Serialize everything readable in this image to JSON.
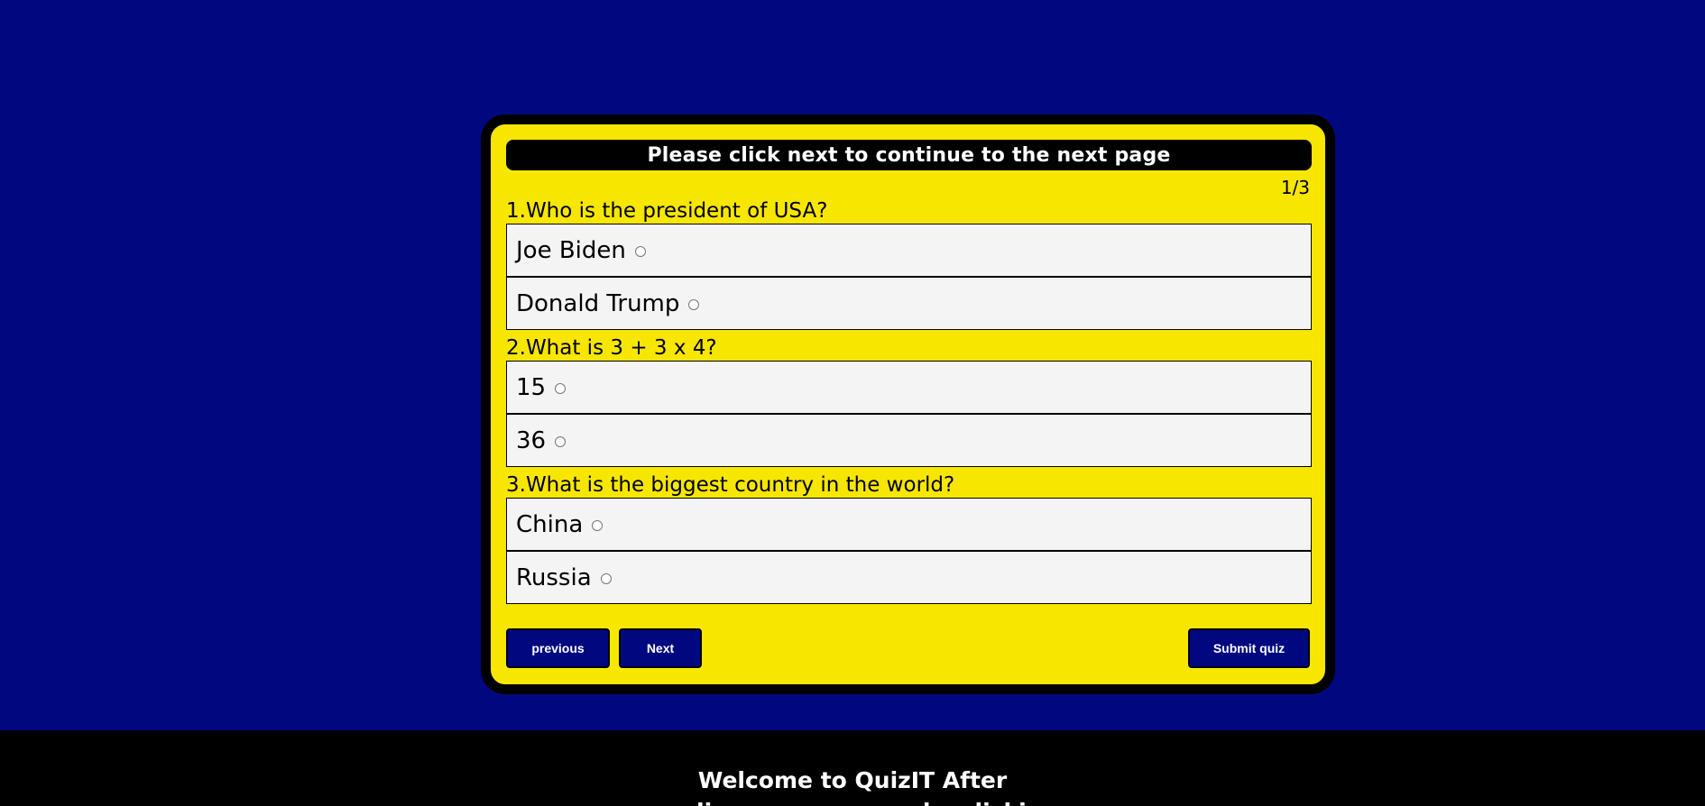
{
  "quiz": {
    "banner": "Please click next to continue to the next page",
    "page_indicator": "1/3",
    "questions": [
      {
        "title": "1.Who is the president of USA?",
        "options": [
          "Joe Biden",
          "Donald Trump"
        ]
      },
      {
        "title": "2.What is 3 + 3 x 4?",
        "options": [
          "15",
          "36"
        ]
      },
      {
        "title": "3.What is the biggest country in the world?",
        "options": [
          "China",
          "Russia"
        ]
      }
    ],
    "buttons": {
      "previous": "previous",
      "next": "Next",
      "submit": "Submit quiz"
    }
  },
  "footer": {
    "line1": "Welcome to QuizIT After",
    "line2": "reading our message by clicking"
  },
  "colors": {
    "page_background": "#00087f",
    "card_background": "#f7e600",
    "button_background": "#00087f",
    "banner_background": "#000000",
    "option_background": "#f4f4f4"
  }
}
